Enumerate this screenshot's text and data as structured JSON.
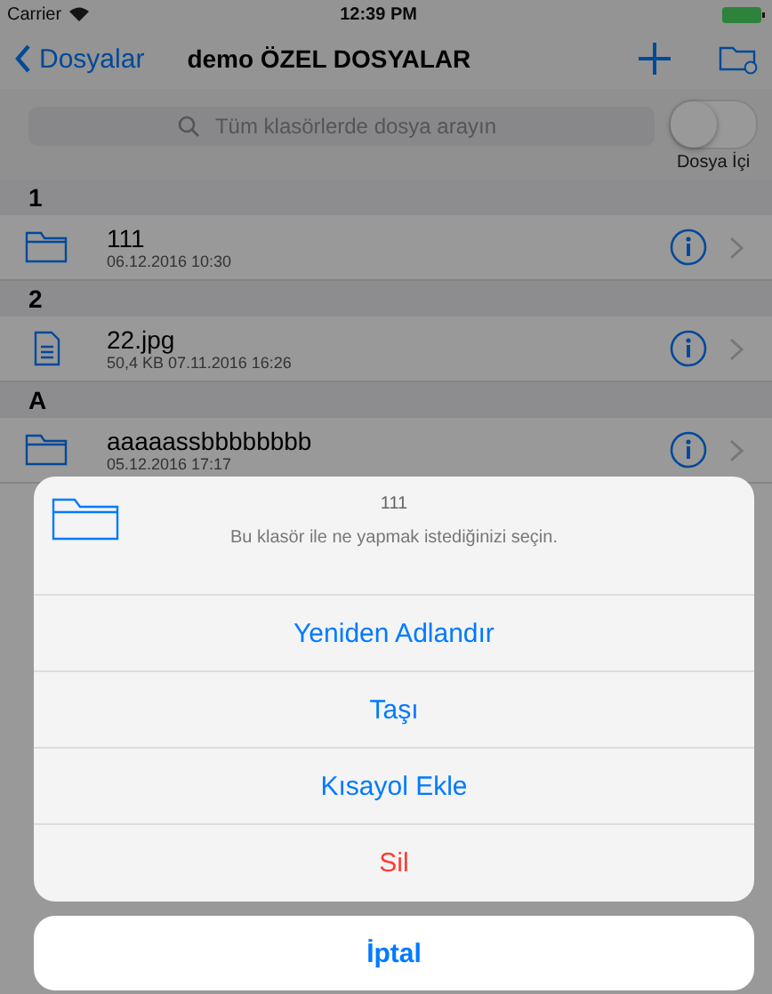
{
  "status_bar": {
    "carrier": "Carrier",
    "time": "12:39 PM"
  },
  "nav": {
    "back": "Dosyalar",
    "title": "demo ÖZEL DOSYALAR"
  },
  "search": {
    "placeholder": "Tüm klasörlerde dosya arayın",
    "toggle": {
      "label": "Dosya İçi",
      "on": false
    }
  },
  "sections": [
    {
      "header": "1",
      "rows": [
        {
          "kind": "folder",
          "name": "111",
          "detail": "06.12.2016 10:30"
        }
      ]
    },
    {
      "header": "2",
      "rows": [
        {
          "kind": "file",
          "name": "22.jpg",
          "detail": "50,4 KB   07.11.2016 16:26"
        }
      ]
    },
    {
      "header": "A",
      "rows": [
        {
          "kind": "folder",
          "name": "aaaaassbbbbbbbb",
          "detail": "05.12.2016 17:17"
        }
      ]
    }
  ],
  "action_sheet": {
    "title": "111",
    "message": "Bu klasör ile ne yapmak istediğinizi seçin.",
    "actions": [
      {
        "label": "Yeniden Adlandır",
        "kind": "default"
      },
      {
        "label": "Taşı",
        "kind": "default"
      },
      {
        "label": "Kısayol Ekle",
        "kind": "default"
      },
      {
        "label": "Sil",
        "kind": "destructive"
      }
    ],
    "cancel": "İptal"
  }
}
